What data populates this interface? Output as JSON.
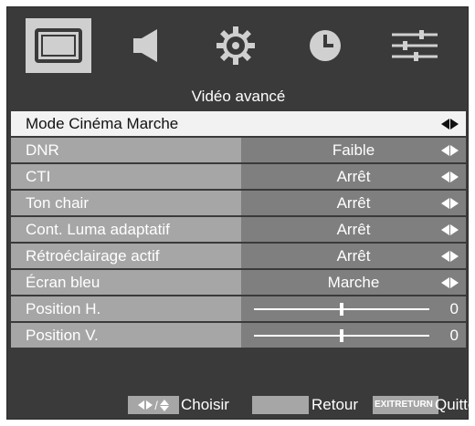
{
  "header": {
    "title": "Vidéo avancé",
    "tabs": [
      {
        "name": "picture",
        "icon": "tv-picture-icon",
        "active": true
      },
      {
        "name": "sound",
        "icon": "speaker-icon",
        "active": false
      },
      {
        "name": "settings",
        "icon": "gear-icon",
        "active": false
      },
      {
        "name": "timer",
        "icon": "clock-icon",
        "active": false
      },
      {
        "name": "options",
        "icon": "sliders-icon",
        "active": false
      }
    ]
  },
  "rows": {
    "mode_cinema": {
      "label": "Mode Cinéma Marche",
      "value": ""
    },
    "dnr": {
      "label": "DNR",
      "value": "Faible"
    },
    "cti": {
      "label": "CTI",
      "value": "Arrêt"
    },
    "ton_chair": {
      "label": "Ton chair",
      "value": "Arrêt"
    },
    "cont_luma": {
      "label": "Cont. Luma adaptatif",
      "value": "Arrêt"
    },
    "retro": {
      "label": "Rétroéclairage actif",
      "value": "Arrêt"
    },
    "ecran_bleu": {
      "label": "Écran bleu",
      "value": "Marche"
    },
    "pos_h": {
      "label": "Position H.",
      "value": "0",
      "slider_fraction": 0.5
    },
    "pos_v": {
      "label": "Position V.",
      "value": "0",
      "slider_fraction": 0.5
    }
  },
  "footer": {
    "choisir": "Choisir",
    "retour": "Retour",
    "exit_key": "EXITRETURN",
    "quitter": "Quitter"
  },
  "colors": {
    "osd_bg": "#3a3a3a",
    "label_bg": "#a6a6a6",
    "value_bg": "#7f7f7f",
    "selected_bg": "#f2f2f2",
    "active_tab_bg": "#cfcfcf"
  }
}
